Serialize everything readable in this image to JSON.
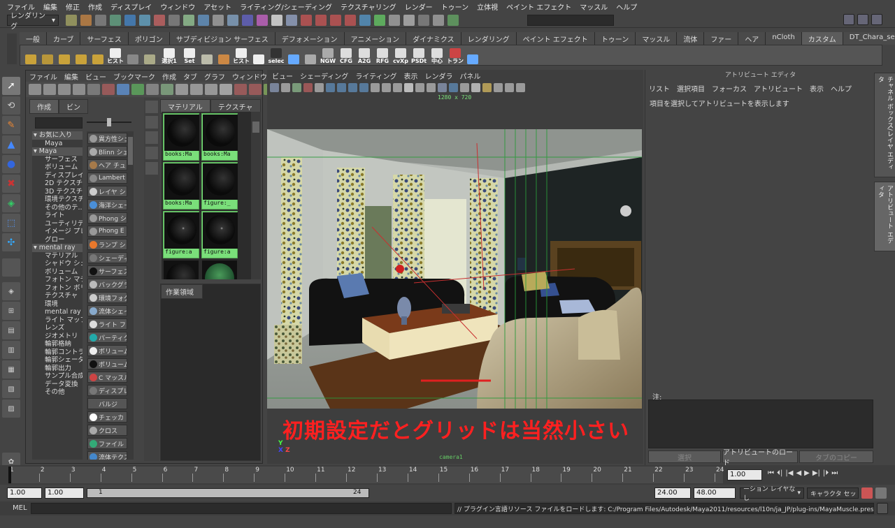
{
  "menubar": [
    "ファイル",
    "編集",
    "修正",
    "作成",
    "ディスプレイ",
    "ウィンドウ",
    "アセット",
    "ライティング/シェーディング",
    "テクスチャリング",
    "レンダー",
    "トゥーン",
    "立体視",
    "ペイント エフェクト",
    "マッスル",
    "ヘルプ"
  ],
  "status": {
    "mode": "レンダリング"
  },
  "shelf_tabs": [
    "一般",
    "カーブ",
    "サーフェス",
    "ポリゴン",
    "サブディビジョン サーフェス",
    "デフォメーション",
    "アニメーション",
    "ダイナミクス",
    "レンダリング",
    "ペイント エフェクト",
    "トゥーン",
    "マッスル",
    "流体",
    "ファー",
    "ヘア",
    "nCloth",
    "カスタム",
    "DT_Chara_setup"
  ],
  "shelf_labels": [
    "ヒスト",
    "選択1",
    "Set",
    "ヒスト",
    "selec",
    "NGW",
    "CFG",
    "A2G",
    "RFG",
    "cvXp",
    "PSDt",
    "中心",
    "トラン"
  ],
  "hypershade": {
    "menu": [
      "ファイル",
      "編集",
      "ビュー",
      "ブックマーク",
      "作成",
      "タブ",
      "グラフ",
      "ウィンドウ"
    ],
    "tabs": [
      "作成",
      "ビン"
    ],
    "tree": [
      {
        "t": "hd",
        "l": "お気に入り"
      },
      {
        "t": "it",
        "l": "Maya"
      },
      {
        "t": "hd",
        "l": "Maya"
      },
      {
        "t": "it",
        "l": "サーフェス"
      },
      {
        "t": "it",
        "l": "ボリューム"
      },
      {
        "t": "it",
        "l": "ディスプレイ..."
      },
      {
        "t": "it",
        "l": "2D テクスチャ"
      },
      {
        "t": "it",
        "l": "3D テクスチャ"
      },
      {
        "t": "it",
        "l": "環境テクスチ..."
      },
      {
        "t": "it",
        "l": "その他のテ..."
      },
      {
        "t": "it",
        "l": "ライト"
      },
      {
        "t": "it",
        "l": "ユーティリティ"
      },
      {
        "t": "it",
        "l": "イメージ プレ"
      },
      {
        "t": "it",
        "l": "グロー"
      },
      {
        "t": "hd",
        "l": "mental ray"
      },
      {
        "t": "it",
        "l": "マテリアル"
      },
      {
        "t": "it",
        "l": "シャドウ シェ..."
      },
      {
        "t": "it",
        "l": "ボリューム"
      },
      {
        "t": "it",
        "l": "フォトン マテ"
      },
      {
        "t": "it",
        "l": "フォトン ボリ..."
      },
      {
        "t": "it",
        "l": "テクスチャ"
      },
      {
        "t": "it",
        "l": "環境"
      },
      {
        "t": "it",
        "l": "mental ray"
      },
      {
        "t": "it",
        "l": "ライト マップ"
      },
      {
        "t": "it",
        "l": "レンズ"
      },
      {
        "t": "it",
        "l": "ジオメトリ"
      },
      {
        "t": "it",
        "l": "輪郭格納"
      },
      {
        "t": "it",
        "l": "輪郭コントラ..."
      },
      {
        "t": "it",
        "l": "輪郭シェーダ"
      },
      {
        "t": "it",
        "l": "輪郭出力"
      },
      {
        "t": "it",
        "l": "サンプル合成"
      },
      {
        "t": "it",
        "l": "データ変換"
      },
      {
        "t": "it",
        "l": "その他"
      }
    ],
    "nodes": [
      {
        "l": "異方性シェ",
        "c": "#9a9a9a"
      },
      {
        "l": "Blinn シェ",
        "c": "#aaa"
      },
      {
        "l": "ヘア チュ",
        "c": "#a67a4a"
      },
      {
        "l": "Lambert",
        "c": "#888"
      },
      {
        "l": "レイヤ シ",
        "c": "#ccc"
      },
      {
        "l": "海洋シェー",
        "c": "#4a8fd8"
      },
      {
        "l": "Phong シ",
        "c": "#999"
      },
      {
        "l": "Phong E",
        "c": "#999"
      },
      {
        "l": "ランプ シ",
        "c": "#e8782c"
      },
      {
        "l": "シェーディ",
        "c": "#777"
      },
      {
        "l": "サーフェス",
        "c": "#111"
      },
      {
        "l": "バックグラ",
        "c": "#bbb"
      },
      {
        "l": "環境フォグ",
        "c": "#ccc"
      },
      {
        "l": "流体シェイ",
        "c": "#8ac"
      },
      {
        "l": "ライト フォ",
        "c": "#ddd"
      },
      {
        "l": "パーティク",
        "c": "#2aa"
      },
      {
        "l": "ボリューム",
        "c": "#eee"
      },
      {
        "l": "ボリューム",
        "c": "#111"
      },
      {
        "l": "C マッスル",
        "c": "#c44"
      },
      {
        "l": "ディスプレ",
        "c": "#777"
      },
      {
        "l": "バルジ",
        "c": "#555"
      },
      {
        "l": "チェッカ",
        "c": "#fff"
      },
      {
        "l": "クロス",
        "c": "#aaa"
      },
      {
        "l": "ファイル",
        "c": "#3a7"
      },
      {
        "l": "流体テクス",
        "c": "#48c"
      }
    ],
    "mat_tabs": [
      "マテリアル",
      "テクスチャ"
    ],
    "swatches": [
      "books:Ma",
      "books:Ma",
      "books:Ma",
      "figure:_",
      "figure:a",
      "figure:a",
      "",
      ""
    ],
    "work_label": "作業領域"
  },
  "viewport": {
    "menu": [
      "ビュー",
      "シェーディング",
      "ライティング",
      "表示",
      "レンダラ",
      "パネル"
    ],
    "resolution": "1280 x 720",
    "camera": "camera1",
    "overlay_text": "初期設定だとグリッドは当然小さい",
    "overlay_color": "#ff2020"
  },
  "attr": {
    "title": "アトリビュート エディタ",
    "menu": [
      "リスト",
      "選択項目",
      "フォーカス",
      "アトリビュート",
      "表示",
      "ヘルプ"
    ],
    "message": "項目を選択してアトリビュートを表示します",
    "note_label": "注:",
    "buttons": [
      "選択",
      "アトリビュートのロード",
      "タブのコピー"
    ],
    "side_tabs": [
      "チャネル ボックス/レイヤ エディタ",
      "アトリビュート エディタ"
    ]
  },
  "timeline": {
    "ticks": [
      "1",
      "2",
      "3",
      "4",
      "5",
      "6",
      "7",
      "8",
      "9",
      "10",
      "11",
      "12",
      "13",
      "14",
      "15",
      "16",
      "17",
      "18",
      "19",
      "20",
      "21",
      "22",
      "23",
      "24"
    ],
    "current": "1.00"
  },
  "range": {
    "start": "1.00",
    "start2": "1.00",
    "slider_start": "1",
    "slider_end": "24",
    "end": "24.00",
    "end2": "48.00",
    "layer": "ーション レイヤなし",
    "char": "キャラクタ セットなし"
  },
  "cmd": {
    "label": "MEL",
    "feedback": "// プラグイン言語リソース ファイルをロードします: C:/Program Files/Autodesk/Maya2011/resources/l10n/ja_JP/plug-ins/MayaMuscle.pres.mel"
  }
}
